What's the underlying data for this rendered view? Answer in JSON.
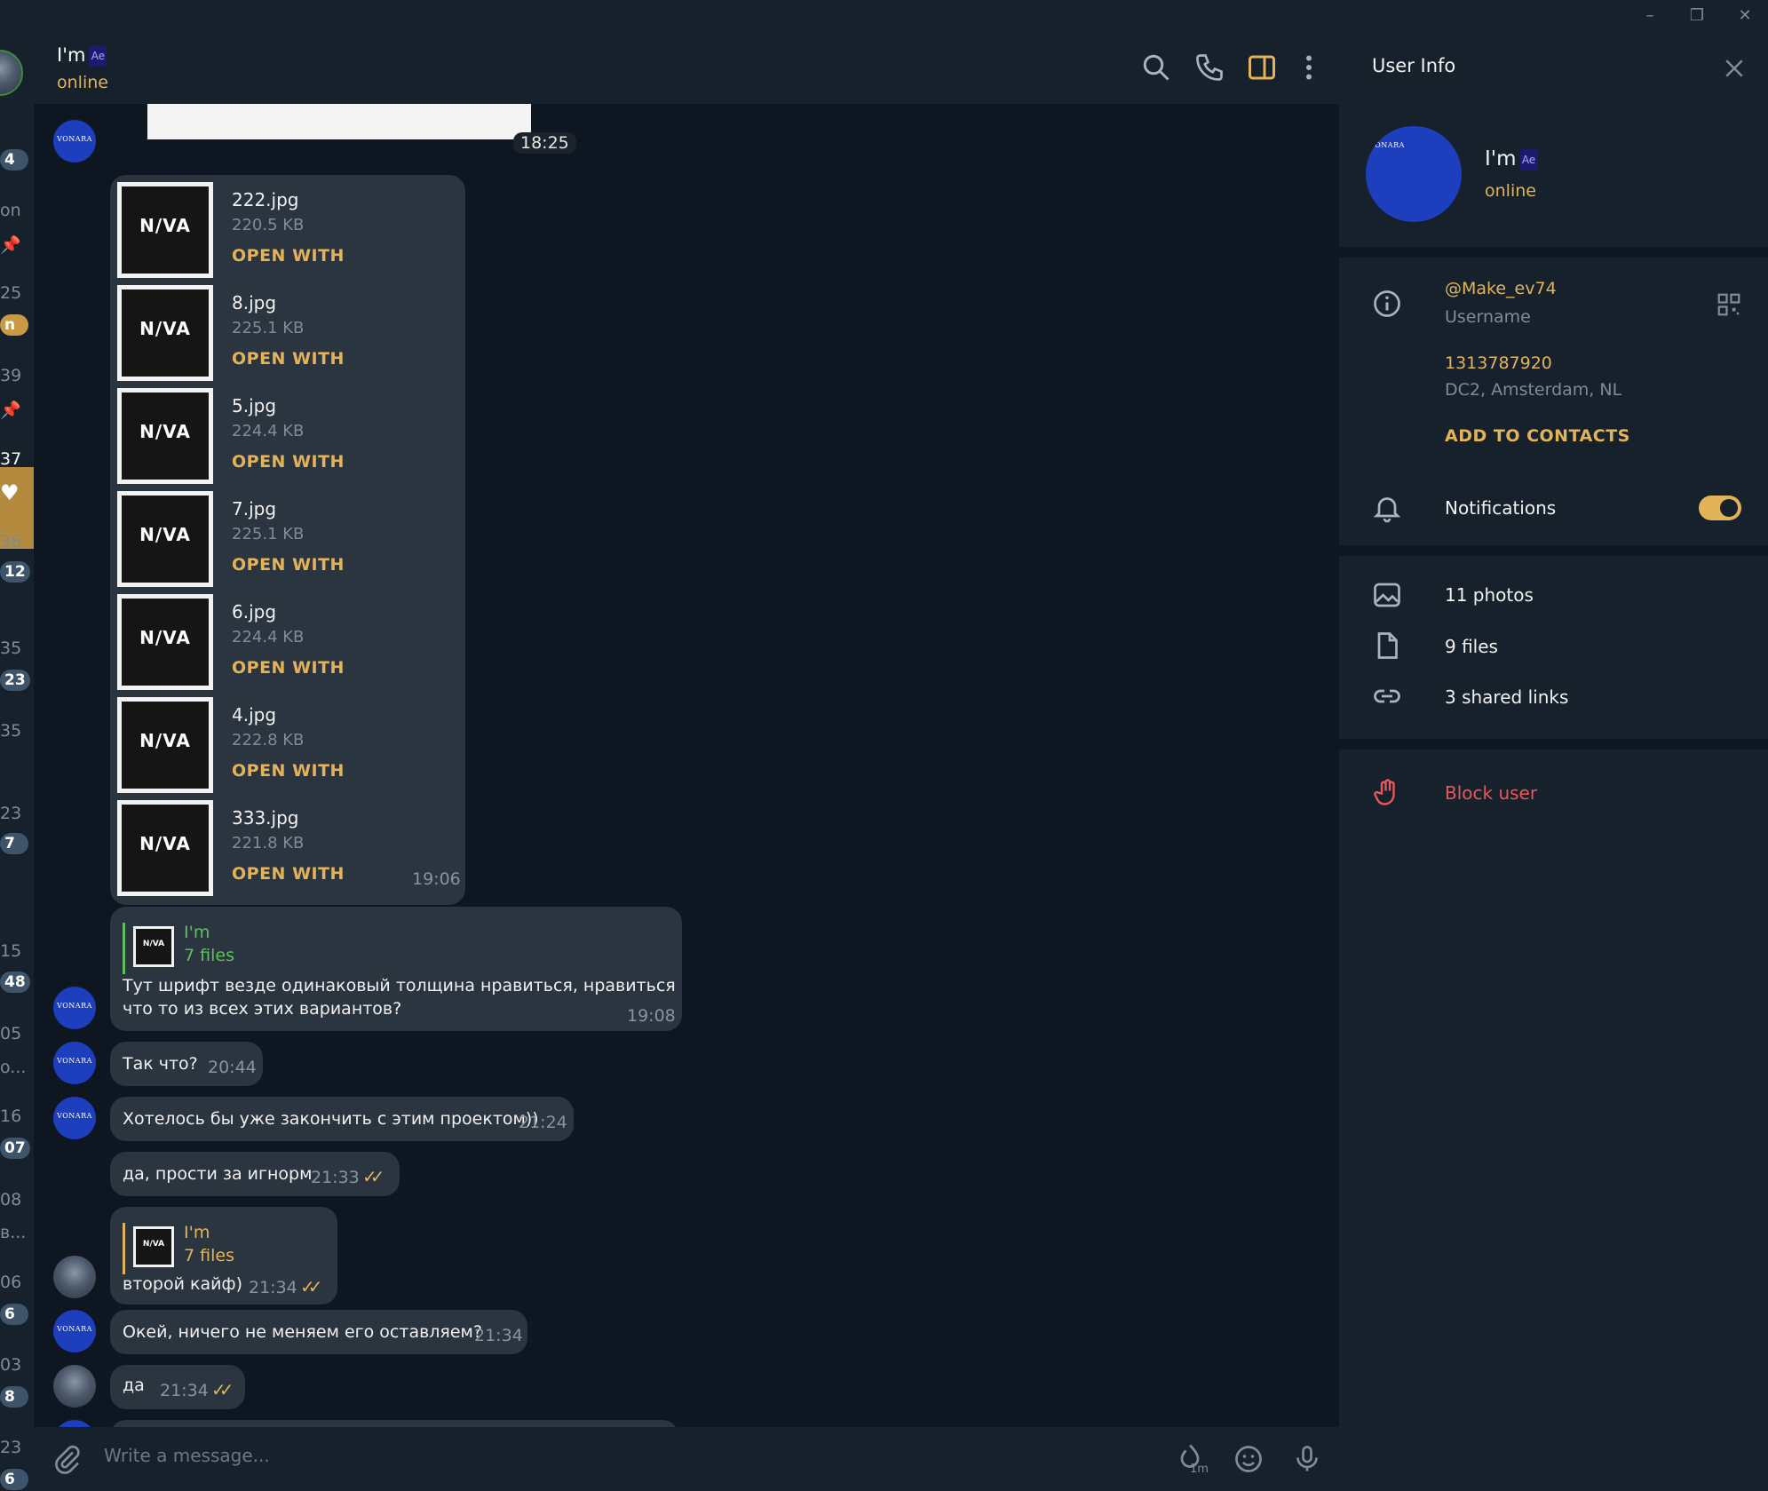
{
  "window": {
    "minimize": "–",
    "restore": "❐",
    "close": "✕"
  },
  "left_strip": {
    "items": [
      "4",
      "on",
      "25",
      "n",
      "39",
      "37",
      "36",
      "12",
      "35",
      "23",
      "35",
      "23",
      "7",
      "15",
      "48",
      "05",
      "o...",
      "16",
      "07",
      "08",
      "в...",
      "06",
      "6",
      "03",
      "8",
      "23",
      "6"
    ]
  },
  "chat": {
    "title": "I'm",
    "title_badge": "Ae",
    "status": "online",
    "input_placeholder": "Write a message...",
    "timer_label": "1m"
  },
  "messages": {
    "top_time": "18:25",
    "files": [
      {
        "name": "222.jpg",
        "size": "220.5 KB",
        "action": "OPEN WITH"
      },
      {
        "name": "8.jpg",
        "size": "225.1 KB",
        "action": "OPEN WITH"
      },
      {
        "name": "5.jpg",
        "size": "224.4 KB",
        "action": "OPEN WITH"
      },
      {
        "name": "7.jpg",
        "size": "225.1 KB",
        "action": "OPEN WITH"
      },
      {
        "name": "6.jpg",
        "size": "224.4 KB",
        "action": "OPEN WITH"
      },
      {
        "name": "4.jpg",
        "size": "222.8 KB",
        "action": "OPEN WITH"
      },
      {
        "name": "333.jpg",
        "size": "221.8 KB",
        "action": "OPEN WITH"
      }
    ],
    "files_time": "19:06",
    "reply1": {
      "author": "I'm",
      "sub": "7 files",
      "text_line1": "Тут шрифт везде одинаковый толщина нравиться, нравиться",
      "text_line2": "что то из всех этих вариантов?",
      "time": "19:08"
    },
    "m2": {
      "text": "Так что?",
      "time": "20:44"
    },
    "m3": {
      "text": "Хотелось бы уже закончить с этим проектом))",
      "time": "21:24"
    },
    "m4": {
      "text": "да, прости за игнорм",
      "time": "21:33"
    },
    "reply2": {
      "author": "I'm",
      "sub": "7 files",
      "text": "второй кайф)",
      "time": "21:34"
    },
    "m6": {
      "text": "Окей, ничего не меняем его оставляем?",
      "time": "21:34"
    },
    "m7": {
      "text": "да",
      "time": "21:34"
    }
  },
  "fab": {
    "badge": "1"
  },
  "user_info": {
    "header": "User Info",
    "name": "I'm",
    "name_badge": "Ae",
    "status": "online",
    "username": "@Make_ev74",
    "username_label": "Username",
    "user_id": "1313787920",
    "dc": "DC2, Amsterdam, NL",
    "add_contacts": "ADD TO CONTACTS",
    "notifications": "Notifications",
    "photos": "11 photos",
    "files": "9 files",
    "links": "3 shared links",
    "block": "Block user"
  },
  "colors": {
    "accent": "#e3b35a",
    "danger": "#e8575c",
    "bubble": "#2b3540",
    "bg": "#0e1621",
    "panel": "#17212b"
  }
}
